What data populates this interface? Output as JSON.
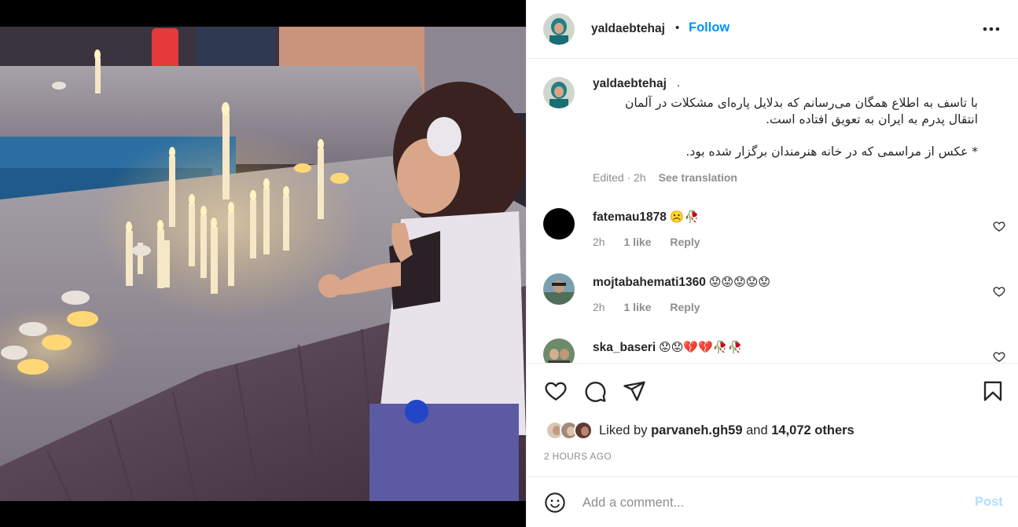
{
  "post": {
    "image_alt": "Child lighting candles by a fountain",
    "author": "yaldaebtehaj",
    "follow_label": "Follow",
    "dot": "•"
  },
  "caption": {
    "username": "yaldaebtehaj",
    "dot": ".",
    "line1": "با تاسف به اطلاع همگان می‌رسانم که بدلایل پاره‌ای مشکلات در آلمان انتقال پدرم به ایران به تعویق افتاده است.",
    "line2": "* عکس از مراسمی که در خانه هنرمندان برگزار شده بود.",
    "meta_edited": "Edited · 2h",
    "see_translation": "See translation"
  },
  "comments": [
    {
      "username": "fatemau1878",
      "text": "☹️🥀",
      "time": "2h",
      "likes": "1 like",
      "reply": "Reply"
    },
    {
      "username": "mojtabahemati1360",
      "text": "😟😟😟😟😟",
      "time": "2h",
      "likes": "1 like",
      "reply": "Reply"
    },
    {
      "username": "ska_baseri",
      "text": "😟😟💔💔🥀🥀",
      "time": "",
      "likes": "",
      "reply": ""
    }
  ],
  "likes": {
    "prefix": "Liked by",
    "liker": "parvaneh.gh59",
    "middle": "and",
    "others": "14,072 others"
  },
  "time_ago": "2 HOURS AGO",
  "add_comment": {
    "placeholder": "Add a comment...",
    "post_label": "Post"
  },
  "colors": {
    "accent": "#0095f6",
    "post_disabled": "#b2dffc",
    "muted": "#8e8e8e",
    "text": "#262626"
  }
}
